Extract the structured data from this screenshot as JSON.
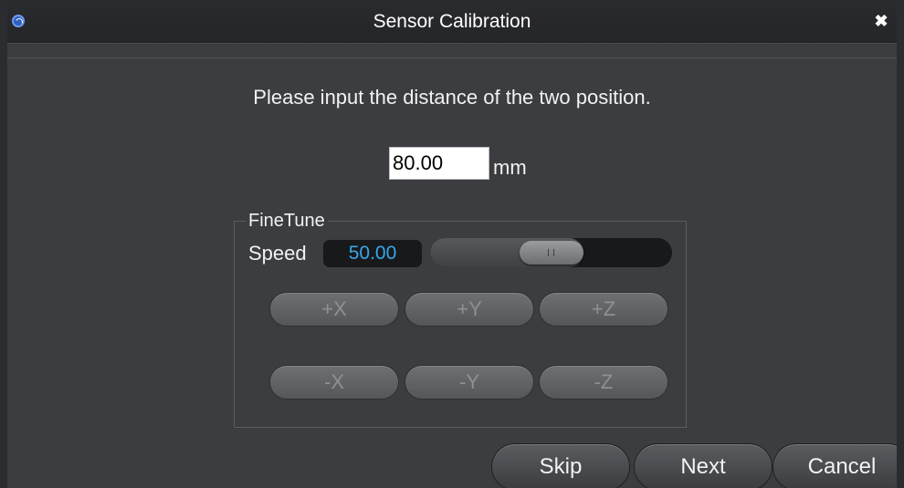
{
  "window": {
    "title": "Sensor Calibration",
    "app_icon": "app-logo-icon",
    "close_icon": "close-icon",
    "close_glyph": "✖"
  },
  "prompt": "Please input the distance of the two position.",
  "distance": {
    "value": "80.00",
    "unit": "mm"
  },
  "finetune": {
    "label": "FineTune",
    "speed_label": "Speed",
    "speed_value": "50.00",
    "slider_fraction": 0.5,
    "buttons_enabled": false,
    "axis_buttons": {
      "plus_x": "+X",
      "plus_y": "+Y",
      "plus_z": "+Z",
      "minus_x": "-X",
      "minus_y": "-Y",
      "minus_z": "-Z"
    }
  },
  "footer": {
    "skip": "Skip",
    "next": "Next",
    "cancel": "Cancel"
  },
  "colors": {
    "window_bg": "#3b3d40",
    "titlebar_bg": "#242528",
    "speed_text": "#37a6ea",
    "disabled_text": "#8e9093"
  }
}
